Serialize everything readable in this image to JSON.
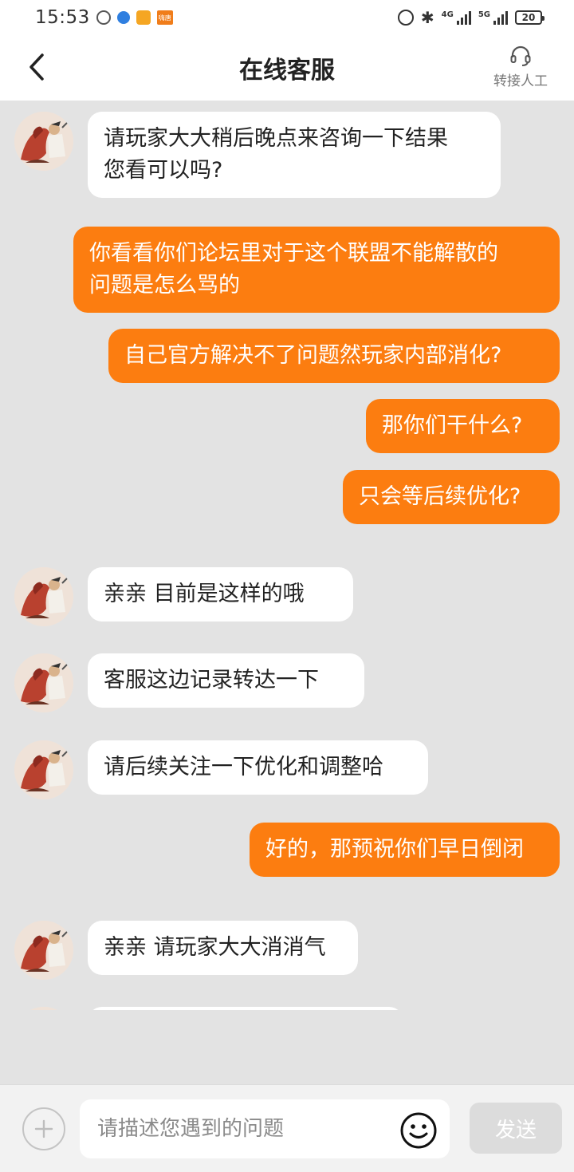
{
  "status_bar": {
    "time": "15:53",
    "network_4g": "4G",
    "network_5g": "5G",
    "battery": "20",
    "app_badge": "嗨唐"
  },
  "header": {
    "title": "在线客服",
    "transfer_label": "转接人工"
  },
  "messages": [
    {
      "side": "left",
      "text": "请玩家大大稍后晚点来咨询一下结果\n您看可以吗?"
    },
    {
      "side": "right",
      "text": "你看看你们论坛里对于这个联盟不能解散的\n问题是怎么骂的"
    },
    {
      "side": "right",
      "text": "自己官方解决不了问题然玩家内部消化?"
    },
    {
      "side": "right",
      "text": "那你们干什么?"
    },
    {
      "side": "right",
      "text": "只会等后续优化?"
    },
    {
      "side": "left",
      "text": "亲亲 目前是这样的哦"
    },
    {
      "side": "left",
      "text": "客服这边记录转达一下"
    },
    {
      "side": "left",
      "text": "请后续关注一下优化和调整哈"
    },
    {
      "side": "right",
      "text": "好的，那预祝你们早日倒闭"
    },
    {
      "side": "left",
      "text": "亲亲 请玩家大大消消气"
    }
  ],
  "input": {
    "placeholder": "请描述您遇到的问题",
    "send_label": "发送"
  },
  "colors": {
    "accent": "#fc7d10",
    "chat_background": "#e3e3e3",
    "send_disabled": "#dcdcdc"
  },
  "icons": [
    "back-chevron-icon",
    "headset-icon",
    "plus-icon",
    "smiley-icon",
    "agent-avatar"
  ]
}
